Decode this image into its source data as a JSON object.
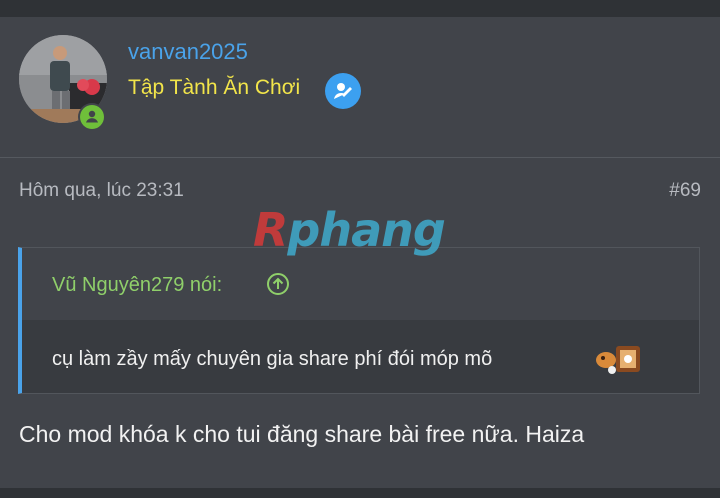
{
  "post": {
    "username": "vanvan2025",
    "user_title": "Tập Tành Ăn Chơi",
    "date": "Hôm qua, lúc 23:31",
    "post_number": "#69",
    "quote": {
      "author": "Vũ Nguyên279 nói:",
      "text": "cụ làm zầy mấy chuyên gia share phí đói móp mõ"
    },
    "message": "Cho mod khóa k cho tui đăng share bài free nữa. Haiza"
  },
  "watermark": {
    "first": "R",
    "rest": "phang"
  },
  "icons": {
    "online": "online-status-icon",
    "verify": "verified-badge-icon",
    "quote_arrow": "arrow-up-circle-icon",
    "emoji": "emoji-sticker-icon"
  },
  "colors": {
    "username": "#4aa3ea",
    "user_title": "#f2e54a",
    "quote_author": "#8fcf6a",
    "quote_border": "#4aa3ea",
    "online": "#6fbf3a"
  }
}
